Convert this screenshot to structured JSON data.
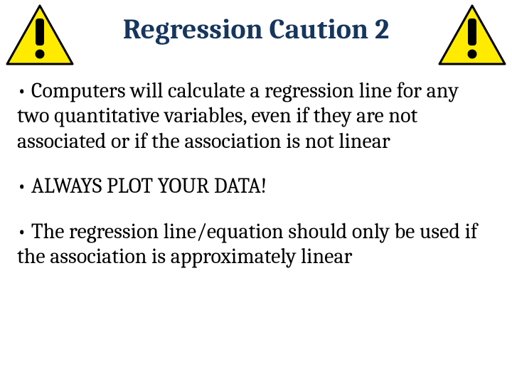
{
  "title": "Regression Caution 2",
  "bullets": [
    "• Computers will calculate a regression line for any two quantitative variables, even if they are not associated or if the association is not linear",
    "• ALWAYS PLOT YOUR DATA!",
    "• The regression line/equation should only be used if the association is approximately linear"
  ]
}
